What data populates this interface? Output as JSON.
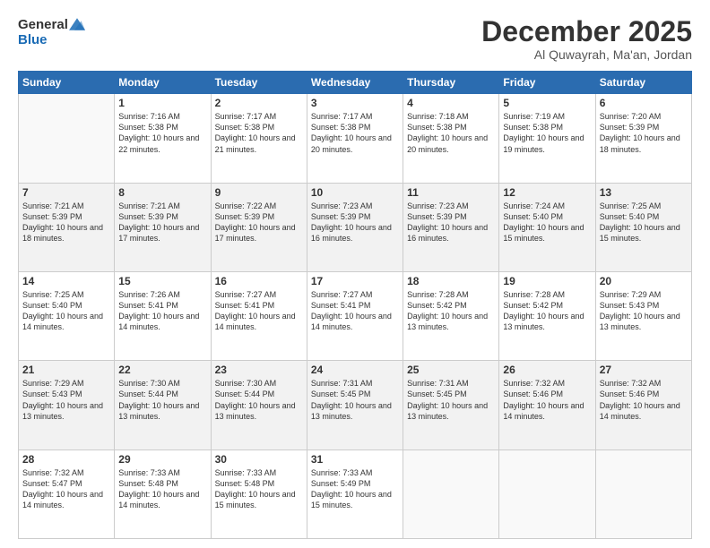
{
  "header": {
    "logo_general": "General",
    "logo_blue": "Blue",
    "month": "December 2025",
    "location": "Al Quwayrah, Ma'an, Jordan"
  },
  "weekdays": [
    "Sunday",
    "Monday",
    "Tuesday",
    "Wednesday",
    "Thursday",
    "Friday",
    "Saturday"
  ],
  "weeks": [
    [
      {
        "day": "",
        "sunrise": "",
        "sunset": "",
        "daylight": ""
      },
      {
        "day": "1",
        "sunrise": "Sunrise: 7:16 AM",
        "sunset": "Sunset: 5:38 PM",
        "daylight": "Daylight: 10 hours and 22 minutes."
      },
      {
        "day": "2",
        "sunrise": "Sunrise: 7:17 AM",
        "sunset": "Sunset: 5:38 PM",
        "daylight": "Daylight: 10 hours and 21 minutes."
      },
      {
        "day": "3",
        "sunrise": "Sunrise: 7:17 AM",
        "sunset": "Sunset: 5:38 PM",
        "daylight": "Daylight: 10 hours and 20 minutes."
      },
      {
        "day": "4",
        "sunrise": "Sunrise: 7:18 AM",
        "sunset": "Sunset: 5:38 PM",
        "daylight": "Daylight: 10 hours and 20 minutes."
      },
      {
        "day": "5",
        "sunrise": "Sunrise: 7:19 AM",
        "sunset": "Sunset: 5:38 PM",
        "daylight": "Daylight: 10 hours and 19 minutes."
      },
      {
        "day": "6",
        "sunrise": "Sunrise: 7:20 AM",
        "sunset": "Sunset: 5:39 PM",
        "daylight": "Daylight: 10 hours and 18 minutes."
      }
    ],
    [
      {
        "day": "7",
        "sunrise": "Sunrise: 7:21 AM",
        "sunset": "Sunset: 5:39 PM",
        "daylight": "Daylight: 10 hours and 18 minutes."
      },
      {
        "day": "8",
        "sunrise": "Sunrise: 7:21 AM",
        "sunset": "Sunset: 5:39 PM",
        "daylight": "Daylight: 10 hours and 17 minutes."
      },
      {
        "day": "9",
        "sunrise": "Sunrise: 7:22 AM",
        "sunset": "Sunset: 5:39 PM",
        "daylight": "Daylight: 10 hours and 17 minutes."
      },
      {
        "day": "10",
        "sunrise": "Sunrise: 7:23 AM",
        "sunset": "Sunset: 5:39 PM",
        "daylight": "Daylight: 10 hours and 16 minutes."
      },
      {
        "day": "11",
        "sunrise": "Sunrise: 7:23 AM",
        "sunset": "Sunset: 5:39 PM",
        "daylight": "Daylight: 10 hours and 16 minutes."
      },
      {
        "day": "12",
        "sunrise": "Sunrise: 7:24 AM",
        "sunset": "Sunset: 5:40 PM",
        "daylight": "Daylight: 10 hours and 15 minutes."
      },
      {
        "day": "13",
        "sunrise": "Sunrise: 7:25 AM",
        "sunset": "Sunset: 5:40 PM",
        "daylight": "Daylight: 10 hours and 15 minutes."
      }
    ],
    [
      {
        "day": "14",
        "sunrise": "Sunrise: 7:25 AM",
        "sunset": "Sunset: 5:40 PM",
        "daylight": "Daylight: 10 hours and 14 minutes."
      },
      {
        "day": "15",
        "sunrise": "Sunrise: 7:26 AM",
        "sunset": "Sunset: 5:41 PM",
        "daylight": "Daylight: 10 hours and 14 minutes."
      },
      {
        "day": "16",
        "sunrise": "Sunrise: 7:27 AM",
        "sunset": "Sunset: 5:41 PM",
        "daylight": "Daylight: 10 hours and 14 minutes."
      },
      {
        "day": "17",
        "sunrise": "Sunrise: 7:27 AM",
        "sunset": "Sunset: 5:41 PM",
        "daylight": "Daylight: 10 hours and 14 minutes."
      },
      {
        "day": "18",
        "sunrise": "Sunrise: 7:28 AM",
        "sunset": "Sunset: 5:42 PM",
        "daylight": "Daylight: 10 hours and 13 minutes."
      },
      {
        "day": "19",
        "sunrise": "Sunrise: 7:28 AM",
        "sunset": "Sunset: 5:42 PM",
        "daylight": "Daylight: 10 hours and 13 minutes."
      },
      {
        "day": "20",
        "sunrise": "Sunrise: 7:29 AM",
        "sunset": "Sunset: 5:43 PM",
        "daylight": "Daylight: 10 hours and 13 minutes."
      }
    ],
    [
      {
        "day": "21",
        "sunrise": "Sunrise: 7:29 AM",
        "sunset": "Sunset: 5:43 PM",
        "daylight": "Daylight: 10 hours and 13 minutes."
      },
      {
        "day": "22",
        "sunrise": "Sunrise: 7:30 AM",
        "sunset": "Sunset: 5:44 PM",
        "daylight": "Daylight: 10 hours and 13 minutes."
      },
      {
        "day": "23",
        "sunrise": "Sunrise: 7:30 AM",
        "sunset": "Sunset: 5:44 PM",
        "daylight": "Daylight: 10 hours and 13 minutes."
      },
      {
        "day": "24",
        "sunrise": "Sunrise: 7:31 AM",
        "sunset": "Sunset: 5:45 PM",
        "daylight": "Daylight: 10 hours and 13 minutes."
      },
      {
        "day": "25",
        "sunrise": "Sunrise: 7:31 AM",
        "sunset": "Sunset: 5:45 PM",
        "daylight": "Daylight: 10 hours and 13 minutes."
      },
      {
        "day": "26",
        "sunrise": "Sunrise: 7:32 AM",
        "sunset": "Sunset: 5:46 PM",
        "daylight": "Daylight: 10 hours and 14 minutes."
      },
      {
        "day": "27",
        "sunrise": "Sunrise: 7:32 AM",
        "sunset": "Sunset: 5:46 PM",
        "daylight": "Daylight: 10 hours and 14 minutes."
      }
    ],
    [
      {
        "day": "28",
        "sunrise": "Sunrise: 7:32 AM",
        "sunset": "Sunset: 5:47 PM",
        "daylight": "Daylight: 10 hours and 14 minutes."
      },
      {
        "day": "29",
        "sunrise": "Sunrise: 7:33 AM",
        "sunset": "Sunset: 5:48 PM",
        "daylight": "Daylight: 10 hours and 14 minutes."
      },
      {
        "day": "30",
        "sunrise": "Sunrise: 7:33 AM",
        "sunset": "Sunset: 5:48 PM",
        "daylight": "Daylight: 10 hours and 15 minutes."
      },
      {
        "day": "31",
        "sunrise": "Sunrise: 7:33 AM",
        "sunset": "Sunset: 5:49 PM",
        "daylight": "Daylight: 10 hours and 15 minutes."
      },
      {
        "day": "",
        "sunrise": "",
        "sunset": "",
        "daylight": ""
      },
      {
        "day": "",
        "sunrise": "",
        "sunset": "",
        "daylight": ""
      },
      {
        "day": "",
        "sunrise": "",
        "sunset": "",
        "daylight": ""
      }
    ]
  ]
}
